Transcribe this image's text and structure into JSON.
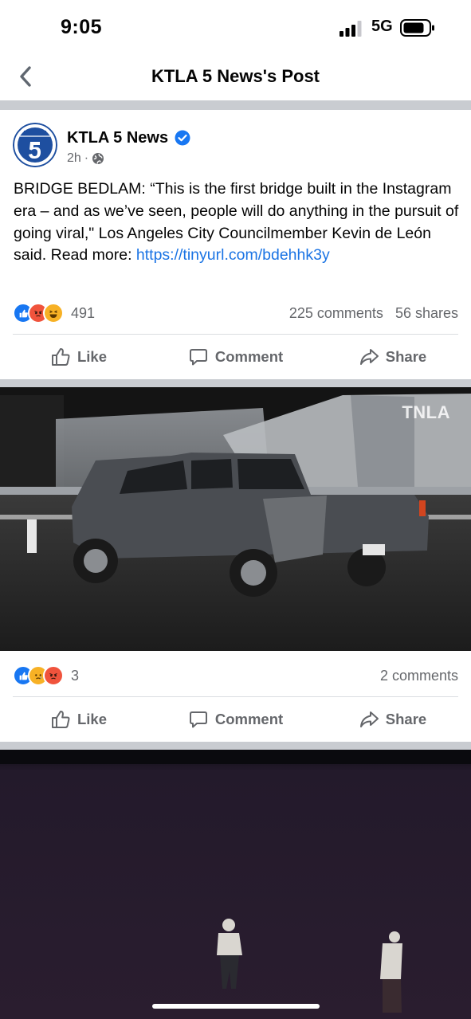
{
  "status_bar": {
    "time": "9:05",
    "network": "5G"
  },
  "nav": {
    "title": "KTLA 5 News's Post"
  },
  "post": {
    "page_name": "KTLA 5 News",
    "time_ago": "2h",
    "text": "BRIDGE BEDLAM: “This is the first bridge built in the Instagram era – and as we’ve seen, people will do anything in the pursuit of going viral,\" Los Angeles City Councilmember Kevin de León said. Read more: ",
    "link": "https://tinyurl.com/bdehhk3y",
    "reaction_count": "491",
    "comments": "225 comments",
    "shares": "56 shares",
    "actions": {
      "like": "Like",
      "comment": "Comment",
      "share": "Share"
    }
  },
  "photo1": {
    "watermark": "TNLA",
    "reaction_count": "3",
    "comments": "2 comments",
    "actions": {
      "like": "Like",
      "comment": "Comment",
      "share": "Share"
    }
  },
  "colors": {
    "accent": "#1b74e4",
    "like": "#1877f2",
    "angry": "#f0533c",
    "haha": "#f7b125",
    "divider": "#c9ccd1"
  },
  "icons": [
    "back-chevron-icon",
    "verified-badge-icon",
    "globe-icon",
    "like-reaction-icon",
    "angry-reaction-icon",
    "haha-reaction-icon",
    "sad-reaction-icon",
    "thumbs-up-icon",
    "comment-bubble-icon",
    "share-arrow-icon"
  ]
}
